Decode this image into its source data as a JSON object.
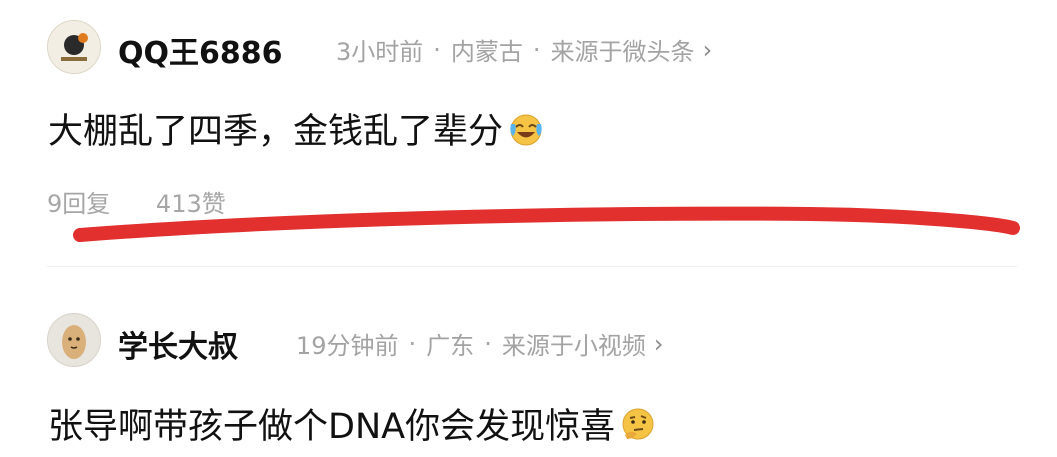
{
  "comments": [
    {
      "username": "QQ王6886",
      "time": "3小时前",
      "location": "内蒙古",
      "source": "来源于微头条",
      "text": "大棚乱了四季，金钱乱了辈分",
      "emoji": "crying-laughing-emoji",
      "replies": "9回复",
      "likes": "413赞"
    },
    {
      "username": "学长大叔",
      "time": "19分钟前",
      "location": "广东",
      "source": "来源于小视频",
      "text": "张导啊带孩子做个DNA你会发现惊喜",
      "emoji": "thinking-emoji"
    }
  ],
  "separator_dot": "·",
  "chevron": "›",
  "colors": {
    "annotation_stroke": "#e2302f",
    "meta_text": "#a3a3a3",
    "body_text": "#111111"
  }
}
